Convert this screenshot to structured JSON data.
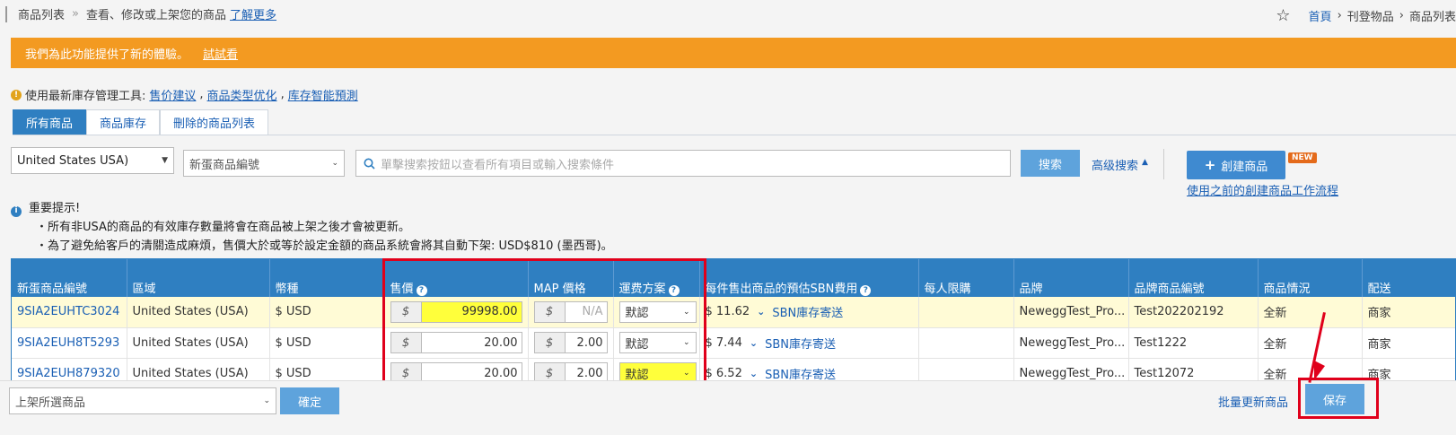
{
  "breadcrumb": {
    "current": "商品列表",
    "separator": "»",
    "description": "查看、修改或上架您的商品",
    "learn_more": "了解更多",
    "nav": [
      "首頁",
      "刊登物品",
      "商品列表"
    ]
  },
  "banner": {
    "text": "我們為此功能提供了新的體驗。",
    "link": "試試看"
  },
  "tools": {
    "prefix": "使用最新庫存管理工具:",
    "links": [
      "售价建议",
      "商品类型优化",
      "库存智能預測"
    ]
  },
  "tabs": [
    {
      "label": "所有商品",
      "active": true
    },
    {
      "label": "商品庫存",
      "active": false
    },
    {
      "label": "刪除的商品列表",
      "active": false
    }
  ],
  "filters": {
    "region": "United States USA)",
    "field": "新蛋商品編號",
    "search_placeholder": "單擊搜索按鈕以查看所有項目或輸入搜索條件",
    "search_button": "搜索",
    "advanced": "高级搜索",
    "create_button": "創建商品",
    "new_badge": "NEW",
    "old_flow": "使用之前的創建商品工作流程"
  },
  "notice": {
    "title": "重要提示!",
    "lines": [
      "・所有非USA的商品的有效庫存數量將會在商品被上架之後才會被更新。",
      "・為了避免給客戶的清關造成麻煩，售價大於或等於設定金額的商品系統會將其自動下架: USD$810 (墨西哥)。"
    ]
  },
  "table": {
    "headers": [
      "新蛋商品編號",
      "區域",
      "幣種",
      "售價",
      "MAP 價格",
      "運费方案",
      "每件售出商品的預估SBN費用",
      "每人限購",
      "品牌",
      "品牌商品編號",
      "商品情況",
      "配送"
    ],
    "currency_symbol": "$",
    "rows": [
      {
        "sku": "9SIA2EUHTC3024",
        "region": "United States (USA)",
        "currency": "$ USD",
        "price": "99998.00",
        "map": "N/A",
        "shipping": "默認",
        "sbn_fee": "$ 11.62",
        "sbn_link": "SBN庫存寄送",
        "limit": "",
        "brand": "NeweggTest_Pro...",
        "brand_sku": "Test202202192",
        "condition": "全新",
        "delivery": "商家"
      },
      {
        "sku": "9SIA2EUH8T5293",
        "region": "United States (USA)",
        "currency": "$ USD",
        "price": "20.00",
        "map": "2.00",
        "shipping": "默認",
        "sbn_fee": "$ 7.44",
        "sbn_link": "SBN庫存寄送",
        "limit": "",
        "brand": "NeweggTest_Pro...",
        "brand_sku": "Test1222",
        "condition": "全新",
        "delivery": "商家"
      },
      {
        "sku": "9SIA2EUH879320",
        "region": "United States (USA)",
        "currency": "$ USD",
        "price": "20.00",
        "map": "2.00",
        "shipping": "默認",
        "sbn_fee": "$ 6.52",
        "sbn_link": "SBN庫存寄送",
        "limit": "",
        "brand": "NeweggTest_Pro...",
        "brand_sku": "Test12072",
        "condition": "全新",
        "delivery": "商家"
      }
    ]
  },
  "footer": {
    "bulk_action": "上架所選商品",
    "confirm": "確定",
    "bulk_update": "批量更新商品",
    "save": "保存"
  },
  "colors": {
    "accent": "#2f7fc1",
    "banner": "#f39a21",
    "highlight": "#ffff3b",
    "annotation": "#e0001b"
  }
}
